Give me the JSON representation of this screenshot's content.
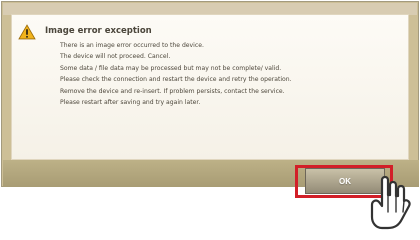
{
  "dialog": {
    "title": "Image error exception",
    "message_lines": [
      "There is an image error occurred to the device. ",
      "The device will not proceed. Cancel.",
      "Some data / file data may be processed but may not be complete/ valid.",
      "Please check the connection and restart the device and retry the operation.",
      "Remove the device and re-insert. If problem persists, contact the service.",
      "Please restart after saving and try again later."
    ],
    "ok_label": "OK"
  },
  "colors": {
    "dialog_background": "#cdbf97",
    "message_panel": "#f8f5ed",
    "highlight": "#d21f28",
    "warning": "#f1b31c"
  },
  "icons": {
    "warning": "warning-icon",
    "pointer": "hand-pointer-icon"
  }
}
